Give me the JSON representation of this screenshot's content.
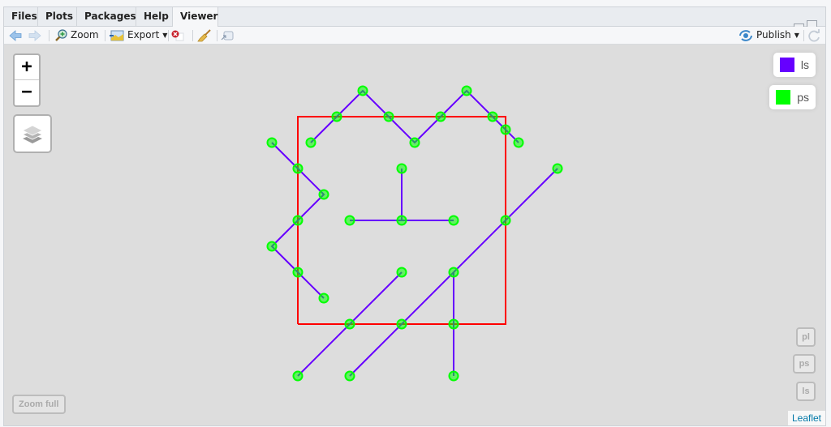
{
  "tabs": [
    {
      "label": "Files",
      "active": false
    },
    {
      "label": "Plots",
      "active": false
    },
    {
      "label": "Packages",
      "active": false
    },
    {
      "label": "Help",
      "active": false
    },
    {
      "label": "Viewer",
      "active": true
    }
  ],
  "toolbar": {
    "back_icon": "arrow-left-icon",
    "forward_icon": "arrow-right-icon",
    "zoom_label": "Zoom",
    "export_label": "Export",
    "remove_icon": "remove-viewer-icon",
    "clear_icon": "broom-icon",
    "popout_icon": "show-in-new-window-icon",
    "publish_label": "Publish",
    "refresh_icon": "refresh-icon"
  },
  "map": {
    "zoom_in_label": "+",
    "zoom_out_label": "−",
    "layers_icon": "layers-icon",
    "legend": [
      {
        "label": "ls",
        "color": "#6600ff"
      },
      {
        "label": "ps",
        "color": "#00ff00"
      }
    ],
    "layer_buttons": [
      "pl",
      "ps",
      "ls"
    ],
    "zoom_full_label": "Zoom full",
    "attribution": "Leaflet",
    "colors": {
      "polygon_stroke": "#ff0000",
      "line_stroke": "#6600ff",
      "point_fill": "#00ff00",
      "background": "#dddddd"
    },
    "geometry": {
      "polygon": [
        [
          0,
          0
        ],
        [
          8,
          0
        ],
        [
          8,
          8
        ],
        [
          0,
          8
        ],
        [
          0,
          0
        ]
      ],
      "lines": [
        [
          [
            0.5,
            7
          ],
          [
            1.5,
            8
          ],
          [
            2.5,
            9
          ],
          [
            3.5,
            8
          ],
          [
            4.5,
            7
          ],
          [
            5.5,
            8
          ],
          [
            6.5,
            9
          ],
          [
            7.5,
            8
          ],
          [
            8,
            7.5
          ],
          [
            8.5,
            7
          ]
        ],
        [
          [
            -1,
            7
          ],
          [
            0,
            6
          ],
          [
            1,
            5
          ],
          [
            0,
            4
          ],
          [
            -1,
            3
          ],
          [
            0,
            2
          ],
          [
            1,
            1
          ]
        ],
        [
          [
            4,
            6
          ],
          [
            4,
            4
          ]
        ],
        [
          [
            2,
            4
          ],
          [
            6,
            4
          ]
        ],
        [
          [
            10,
            6
          ],
          [
            2,
            -2
          ]
        ],
        [
          [
            4,
            2
          ],
          [
            0,
            -2
          ]
        ],
        [
          [
            6,
            2
          ],
          [
            6,
            -2
          ]
        ]
      ],
      "points": [
        [
          2.5,
          9
        ],
        [
          1.5,
          8
        ],
        [
          0.5,
          7
        ],
        [
          3.5,
          8
        ],
        [
          4.5,
          7
        ],
        [
          5.5,
          8
        ],
        [
          6.5,
          9
        ],
        [
          7.5,
          8
        ],
        [
          8,
          7.5
        ],
        [
          8.5,
          7
        ],
        [
          -1,
          7
        ],
        [
          0,
          6
        ],
        [
          1,
          5
        ],
        [
          0,
          4
        ],
        [
          -1,
          3
        ],
        [
          0,
          2
        ],
        [
          1,
          1
        ],
        [
          4,
          6
        ],
        [
          2,
          4
        ],
        [
          4,
          4
        ],
        [
          6,
          4
        ],
        [
          10,
          6
        ],
        [
          8,
          4
        ],
        [
          6,
          2
        ],
        [
          4,
          0
        ],
        [
          2,
          -2
        ],
        [
          4,
          2
        ],
        [
          2,
          0
        ],
        [
          0,
          -2
        ],
        [
          6,
          0
        ],
        [
          6,
          -2
        ]
      ]
    }
  }
}
